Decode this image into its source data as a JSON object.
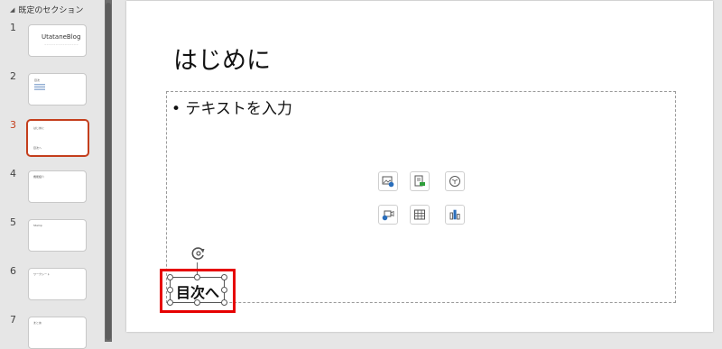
{
  "section": {
    "name": "既定のセクション"
  },
  "slides": [
    {
      "num": "1",
      "text": "UtataneBlog",
      "sub": "~~~~~~~~~~~~~~~"
    },
    {
      "num": "2",
      "text": "目次"
    },
    {
      "num": "3",
      "text": "はじめに",
      "sub": "目次へ",
      "selected": true
    },
    {
      "num": "4",
      "text": "機能紹介"
    },
    {
      "num": "5",
      "text": "Stamp"
    },
    {
      "num": "6",
      "text": "ワークシート"
    },
    {
      "num": "7",
      "text": "まとめ"
    }
  ],
  "editor": {
    "title": "はじめに",
    "placeholder": "• テキストを入力",
    "textbox": "目次へ"
  },
  "insert_icons": [
    "picture-icon",
    "smartart-icon",
    "3d-model-icon",
    "video-icon",
    "table-icon",
    "chart-icon"
  ],
  "colors": {
    "selection": "#c43e1c",
    "highlight": "#e60000",
    "green_accent": "#2e9e3a",
    "blue_accent": "#2a6ebb"
  }
}
